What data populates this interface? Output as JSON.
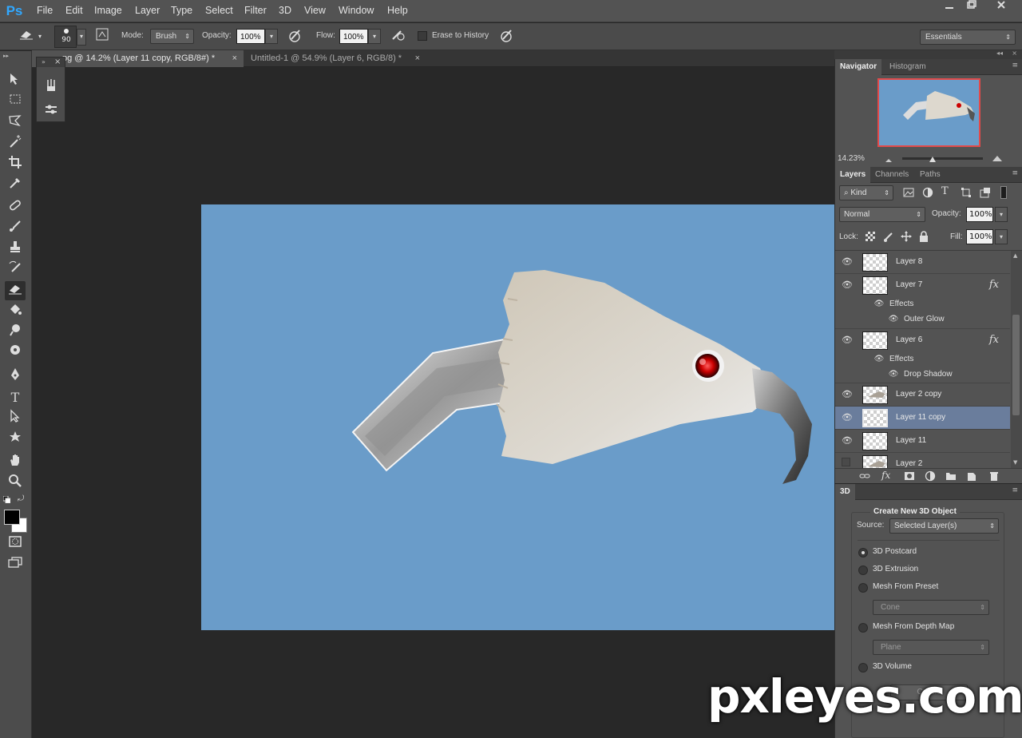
{
  "app": {
    "logo": "Ps"
  },
  "menu": [
    "File",
    "Edit",
    "Image",
    "Layer",
    "Type",
    "Select",
    "Filter",
    "3D",
    "View",
    "Window",
    "Help"
  ],
  "window_controls": [
    "minimize-icon",
    "restore-icon",
    "close-icon"
  ],
  "options_bar": {
    "brush_size": "90",
    "mode_label": "Mode:",
    "mode_value": "Brush",
    "opacity_label": "Opacity:",
    "opacity_value": "100%",
    "flow_label": "Flow:",
    "flow_value": "100%",
    "erase_history_label": "Erase to History",
    "workspace": "Essentials"
  },
  "tabs": [
    {
      "label": "pg @ 14.2% (Layer 11 copy, RGB/8#) *",
      "active": true
    },
    {
      "label": "Untitled-1 @ 54.9% (Layer 6, RGB/8) *",
      "active": false
    }
  ],
  "navigator": {
    "tabs": [
      "Navigator",
      "Histogram"
    ],
    "zoom": "14.23%"
  },
  "layers_panel": {
    "tabs": [
      "Layers",
      "Channels",
      "Paths"
    ],
    "filter_kind": "Kind",
    "blend_mode": "Normal",
    "opacity_label": "Opacity:",
    "opacity_value": "100%",
    "lock_label": "Lock:",
    "fill_label": "Fill:",
    "fill_value": "100%",
    "layers": [
      {
        "name": "Layer 8",
        "visible": true,
        "fx": false
      },
      {
        "name": "Layer 7",
        "visible": true,
        "fx": true,
        "effects_label": "Effects",
        "effect": "Outer Glow"
      },
      {
        "name": "Layer 6",
        "visible": true,
        "fx": true,
        "effects_label": "Effects",
        "effect": "Drop Shadow"
      },
      {
        "name": "Layer 2 copy",
        "visible": true,
        "fx": false
      },
      {
        "name": "Layer 11 copy",
        "visible": true,
        "fx": false,
        "selected": true
      },
      {
        "name": "Layer 11",
        "visible": true,
        "fx": false
      },
      {
        "name": "Layer 2",
        "visible": false,
        "fx": false
      }
    ],
    "fx_symbol": "fx"
  },
  "panel_3d": {
    "tab": "3D",
    "heading": "Create New 3D Object",
    "source_label": "Source:",
    "source_value": "Selected Layer(s)",
    "options": [
      {
        "label": "3D Postcard",
        "selected": true
      },
      {
        "label": "3D Extrusion",
        "selected": false
      },
      {
        "label": "Mesh From Preset",
        "selected": false,
        "sub": "Cone"
      },
      {
        "label": "Mesh From Depth Map",
        "selected": false,
        "sub": "Plane"
      },
      {
        "label": "3D Volume",
        "selected": false
      }
    ],
    "create_button": "Create"
  },
  "watermark": "pxleyes.com",
  "colors": {
    "canvas_bg": "#6a9cc9",
    "accent": "#31a8ff",
    "selected_layer": "#6a7d9c"
  }
}
